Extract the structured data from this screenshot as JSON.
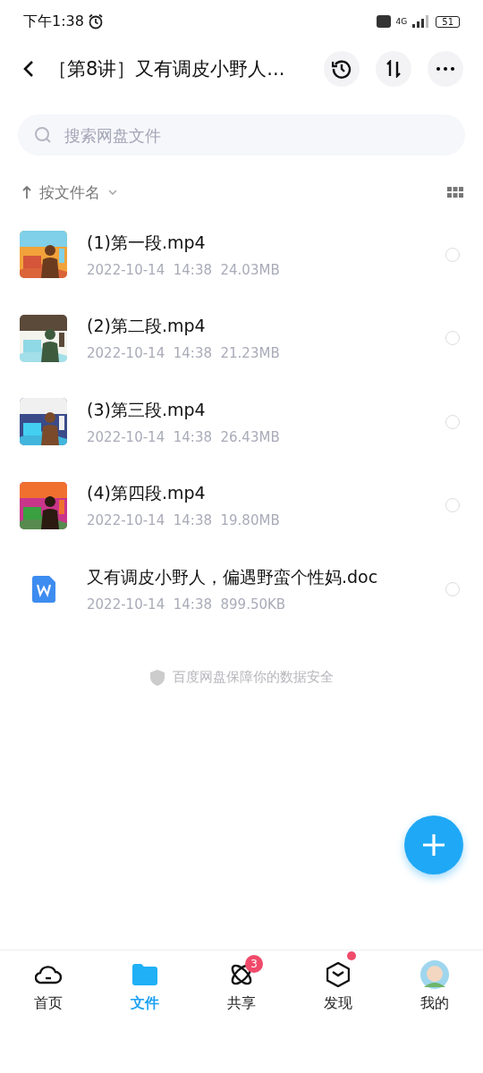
{
  "status_bar": {
    "time": "下午1:38",
    "network": "4G",
    "battery": "51"
  },
  "header": {
    "title": "［第8讲］又有调皮小野人..."
  },
  "search": {
    "placeholder": "搜索网盘文件"
  },
  "sort": {
    "label": "按文件名"
  },
  "files": [
    {
      "kind": "video",
      "name": "(1)第一段.mp4",
      "date": "2022-10-14",
      "time": "14:38",
      "size": "24.03MB",
      "checked": false
    },
    {
      "kind": "video",
      "name": "(2)第二段.mp4",
      "date": "2022-10-14",
      "time": "14:38",
      "size": "21.23MB",
      "checked": false
    },
    {
      "kind": "video",
      "name": "(3)第三段.mp4",
      "date": "2022-10-14",
      "time": "14:38",
      "size": "26.43MB",
      "checked": false
    },
    {
      "kind": "video",
      "name": "(4)第四段.mp4",
      "date": "2022-10-14",
      "time": "14:38",
      "size": "19.80MB",
      "checked": false
    },
    {
      "kind": "doc",
      "name": "又有调皮小野人，偏遇野蛮个性妈.doc",
      "date": "2022-10-14",
      "time": "14:38",
      "size": "899.50KB",
      "checked": false
    }
  ],
  "footer_note": "百度网盘保障你的数据安全",
  "tabs": [
    {
      "kind": "home",
      "label": "首页",
      "selected": false
    },
    {
      "kind": "files",
      "label": "文件",
      "selected": true
    },
    {
      "kind": "share",
      "label": "共享",
      "selected": false,
      "badge": "3"
    },
    {
      "kind": "discover",
      "label": "发现",
      "selected": false,
      "dot": true
    },
    {
      "kind": "me",
      "label": "我的",
      "selected": false
    }
  ]
}
